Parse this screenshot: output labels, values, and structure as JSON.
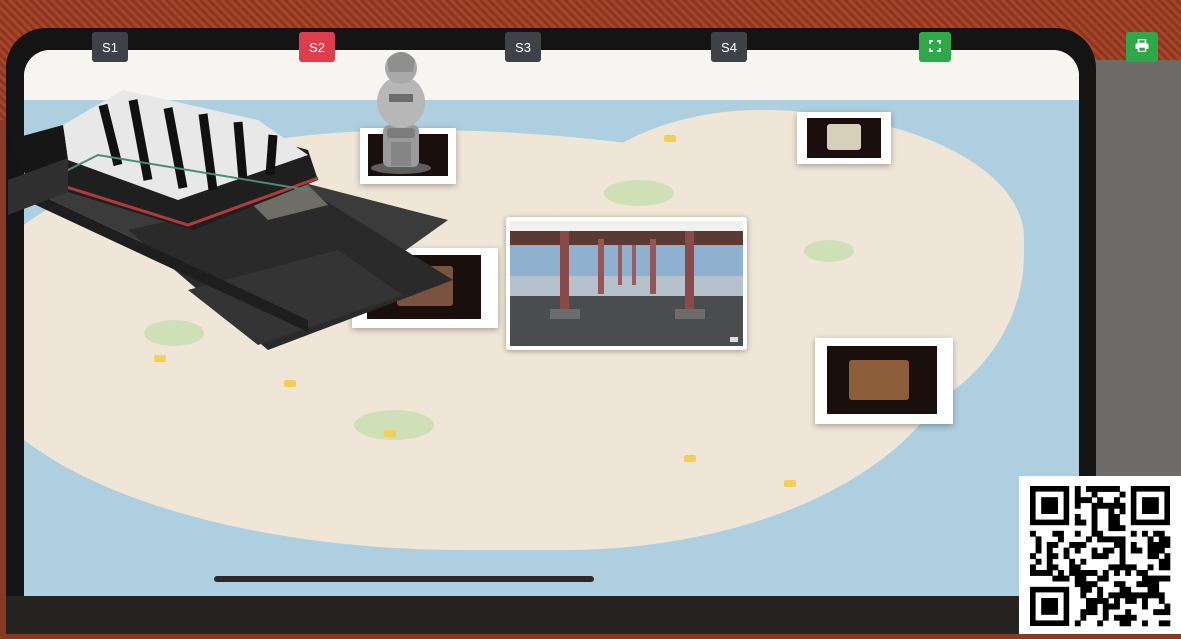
{
  "toolbar": {
    "scenes": [
      {
        "label": "S1",
        "active": false
      },
      {
        "label": "S2",
        "active": true
      },
      {
        "label": "S3",
        "active": false
      },
      {
        "label": "S4",
        "active": false
      }
    ],
    "fullscreen_icon": "fullscreen-icon",
    "print_icon": "print-icon"
  },
  "colors": {
    "scene_button": "#3e4247",
    "scene_button_active": "#dd3d4c",
    "action_button": "#2fa84a"
  },
  "ar_objects": {
    "temple_model": "temple-3d-model",
    "statue_model": "dol-hareubang-3d-model",
    "video_panel": "pavilion-video-panel"
  },
  "qr_code": "qr-code-icon"
}
